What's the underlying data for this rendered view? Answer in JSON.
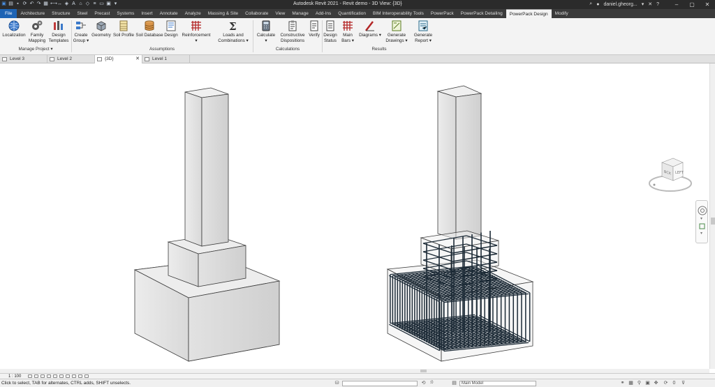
{
  "window": {
    "title": "Autodesk Revit 2021 - Revit demo - 3D View: {3D}",
    "user": "daniel.gheorg...",
    "help": "?"
  },
  "ribbon_tabs": [
    "File",
    "Architecture",
    "Structure",
    "Steel",
    "Precast",
    "Systems",
    "Insert",
    "Annotate",
    "Analyze",
    "Massing & Site",
    "Collaborate",
    "View",
    "Manage",
    "Add-Ins",
    "Quantification",
    "BIM Interoperability Tools",
    "PowerPack",
    "PowerPack Detailing",
    "PowerPack Design",
    "Modify"
  ],
  "ribbon": {
    "buttons": {
      "localization": "Localization",
      "family_mapping_1": "Family",
      "family_mapping_2": "Mapping",
      "design_templates_1": "Design",
      "design_templates_2": "Templates",
      "create_group_1": "Create",
      "create_group_2": "Group",
      "geometry": "Geometry",
      "soil_profile": "Soil Profile",
      "soil_database": "Soil Database",
      "design": "Design",
      "reinforcement": "Reinforcement",
      "loads_1": "Loads and",
      "loads_2": "Combinations",
      "calculate": "Calculate",
      "constructive_1": "Constructive",
      "constructive_2": "Dispositions",
      "verify": "Verify",
      "design_status_1": "Design",
      "design_status_2": "Status",
      "main_bars_1": "Main",
      "main_bars_2": "Bars",
      "diagrams": "Diagrams",
      "generate_drawings_1": "Generate",
      "generate_drawings_2": "Drawings",
      "generate_report_1": "Generate",
      "generate_report_2": "Report"
    },
    "groups": {
      "manage_project": "Manage Project",
      "assumptions": "Assumptions",
      "calculations": "Calculations",
      "results": "Results"
    }
  },
  "doc_tabs": {
    "level3": "Level 3",
    "level2": "Level 2",
    "view3d": "{3D}",
    "level1": "Level 1"
  },
  "viewcube": {
    "face_front": "LEFT",
    "face_left": "BCK"
  },
  "view_bar": {
    "scale": "1 : 100"
  },
  "status": {
    "message": "Click to select, TAB for alternates, CTRL adds, SHIFT unselects.",
    "zero": ":0",
    "model": "Main Model"
  },
  "colors": {
    "file_tab": "#1e64b4",
    "concrete": "#e6e6e6",
    "rebar": "#1c2a36"
  }
}
